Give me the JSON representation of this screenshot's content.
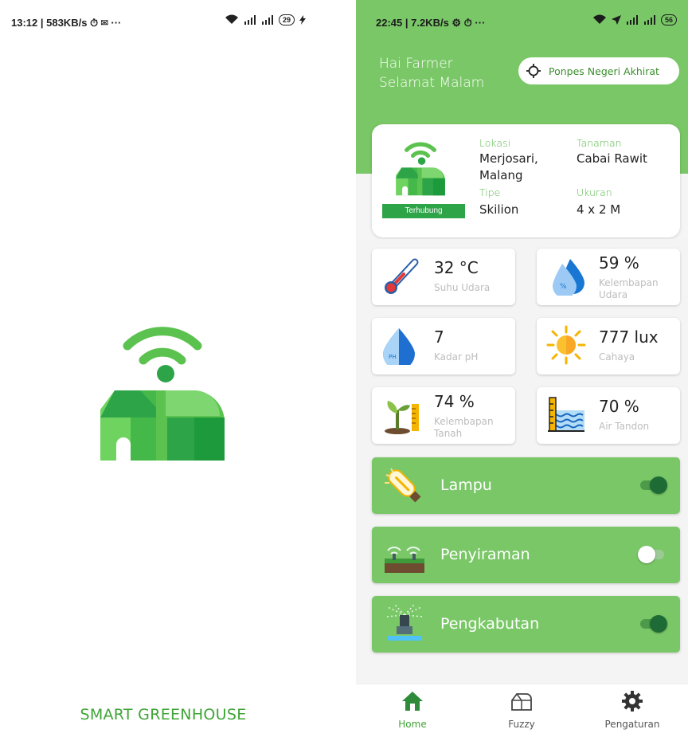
{
  "left_screen": {
    "status_bar": {
      "left_text": "13:12 | 583KB/s ⏱ ✉ ···",
      "battery": "29"
    },
    "app_title": "SMART GREENHOUSE"
  },
  "right_screen": {
    "status_bar": {
      "left_text": "22:45 | 7.2KB/s ⚙ ⏱ ···",
      "battery": "56"
    },
    "greeting": {
      "line1": "Hai Farmer",
      "line2": "Selamat Malam"
    },
    "location_button": "Ponpes Negeri Akhirat",
    "greenhouse": {
      "status_badge": "Terhubung",
      "fields": {
        "location_label": "Lokasi",
        "location_value_1": "Merjosari,",
        "location_value_2": "Malang",
        "plant_label": "Tanaman",
        "plant_value": "Cabai Rawit",
        "type_label": "Tipe",
        "type_value": "Skilion",
        "size_label": "Ukuran",
        "size_value": "4 x 2 M"
      }
    },
    "sensors": {
      "temp": {
        "value": "32 °C",
        "label": "Suhu Udara",
        "icon": "thermometer-icon"
      },
      "humidity": {
        "value": "59 %",
        "label1": "Kelembapan",
        "label2": "Udara",
        "icon": "humidity-drop-icon"
      },
      "ph": {
        "value": "7",
        "label": "Kadar pH",
        "icon": "ph-drop-icon"
      },
      "light": {
        "value": "777 lux",
        "label": "Cahaya",
        "icon": "sun-icon"
      },
      "soil": {
        "value": "74 %",
        "label1": "Kelembapan",
        "label2": "Tanah",
        "icon": "plant-ruler-icon"
      },
      "water": {
        "value": "70 %",
        "label": "Air Tandon",
        "icon": "water-tank-icon"
      }
    },
    "controls": {
      "lamp": {
        "label": "Lampu",
        "state": "on"
      },
      "watering": {
        "label": "Penyiraman",
        "state": "off"
      },
      "misting": {
        "label": "Pengkabutan",
        "state": "on"
      }
    },
    "nav": {
      "home": "Home",
      "fuzzy": "Fuzzy",
      "settings": "Pengaturan"
    },
    "colors": {
      "primary": "#7ac767",
      "accent_dark": "#1e6b36",
      "badge": "#2ea449"
    }
  }
}
